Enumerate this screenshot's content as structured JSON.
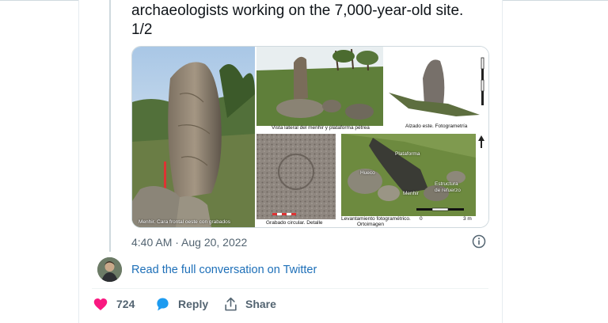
{
  "tweet": {
    "text_line1": "archaeologists working on the 7,000-year-old site.",
    "text_line2": "1/2",
    "timestamp": "4:40 AM · Aug 20, 2022",
    "read_more": "Read the full conversation on Twitter"
  },
  "media": {
    "captions": {
      "menhir_face": "Menhir. Cara frontal oeste con grabados",
      "lateral": "Vista lateral del menhir y plataforma pétrea",
      "alzado": "Alzado este. Fotogrametría",
      "grabado": "Grabado circular. Detalle",
      "levantamiento_1": "Levantamiento fotogramétrico.",
      "levantamiento_2": "Ortoimagen",
      "plataforma": "Plataforma",
      "hueco": "Hueco",
      "estructura": "Estructura",
      "refuerzo": "de refuerzo",
      "menhir_label": "Menhir",
      "scale_0": "0",
      "scale_3": "3 m"
    }
  },
  "actions": {
    "likes": "724",
    "reply_label": "Reply",
    "share_label": "Share"
  },
  "colors": {
    "like": "#f91880",
    "reply": "#1d9bf0",
    "link": "#1d6fb8",
    "muted": "#536471"
  },
  "icons": [
    "heart-icon",
    "reply-bubble-icon",
    "share-icon",
    "info-icon",
    "north-arrow-icon"
  ]
}
